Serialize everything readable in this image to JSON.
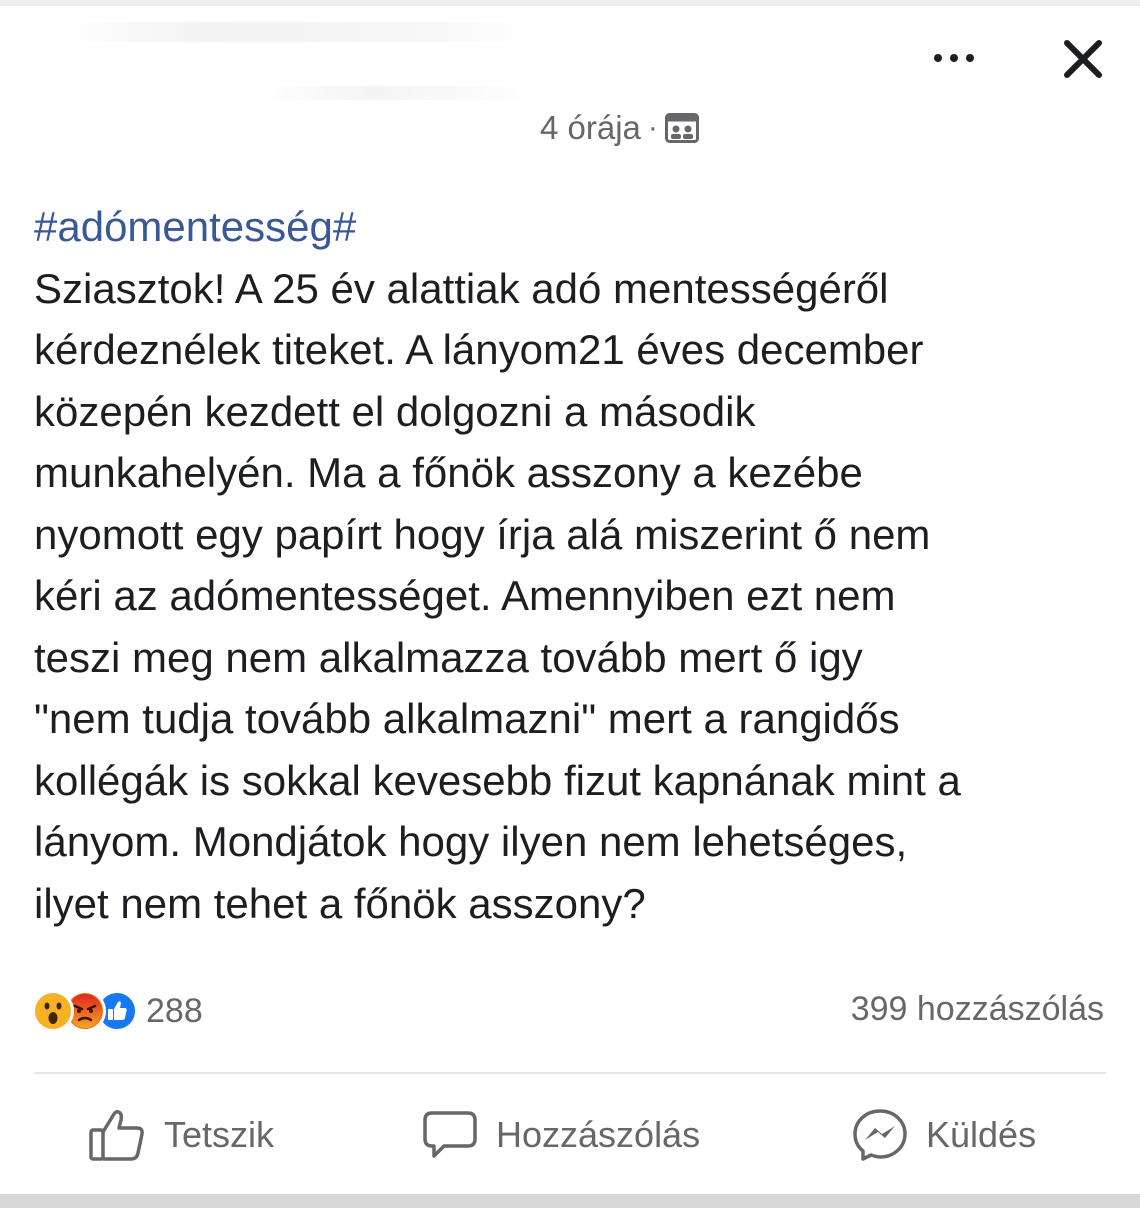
{
  "header": {
    "timestamp": "4 órája",
    "separator": "·",
    "audience_icon": "group-audience-icon",
    "more_icon": "more-options-icon",
    "close_icon": "close-icon"
  },
  "post": {
    "hashtag": "#adómentesség#",
    "lines": [
      "Sziasztok! A 25 év alattiak adó mentességéről",
      "kérdeznélek titeket. A lányom21 éves december",
      "közepén kezdett el dolgozni a második",
      "munkahelyén. Ma a főnök asszony a kezébe",
      "nyomott egy papírt hogy írja alá miszerint ő nem",
      "kéri az adómentességet. Amennyiben ezt nem",
      "teszi meg nem alkalmazza tovább mert ő igy",
      "\"nem tudja tovább alkalmazni\" mert a rangidős",
      "kollégák is sokkal kevesebb fizut kapnának mint a",
      "lányom. Mondjátok hogy ilyen nem lehetséges,",
      "ilyet nem tehet a főnök asszony?"
    ],
    "hashtag_color": "#385898"
  },
  "engagement": {
    "reactions": [
      "wow-reaction-icon",
      "angry-reaction-icon",
      "like-reaction-icon"
    ],
    "reaction_count": "288",
    "comments": "399 hozzászólás"
  },
  "actions": {
    "like": "Tetszik",
    "comment": "Hozzászólás",
    "send": "Küldés"
  },
  "colors": {
    "text": "#1c1e21",
    "secondary": "#65676b",
    "like_blue": "#1877f2",
    "angry_orange": "#e9710f",
    "wow_yellow": "#f7b125"
  }
}
